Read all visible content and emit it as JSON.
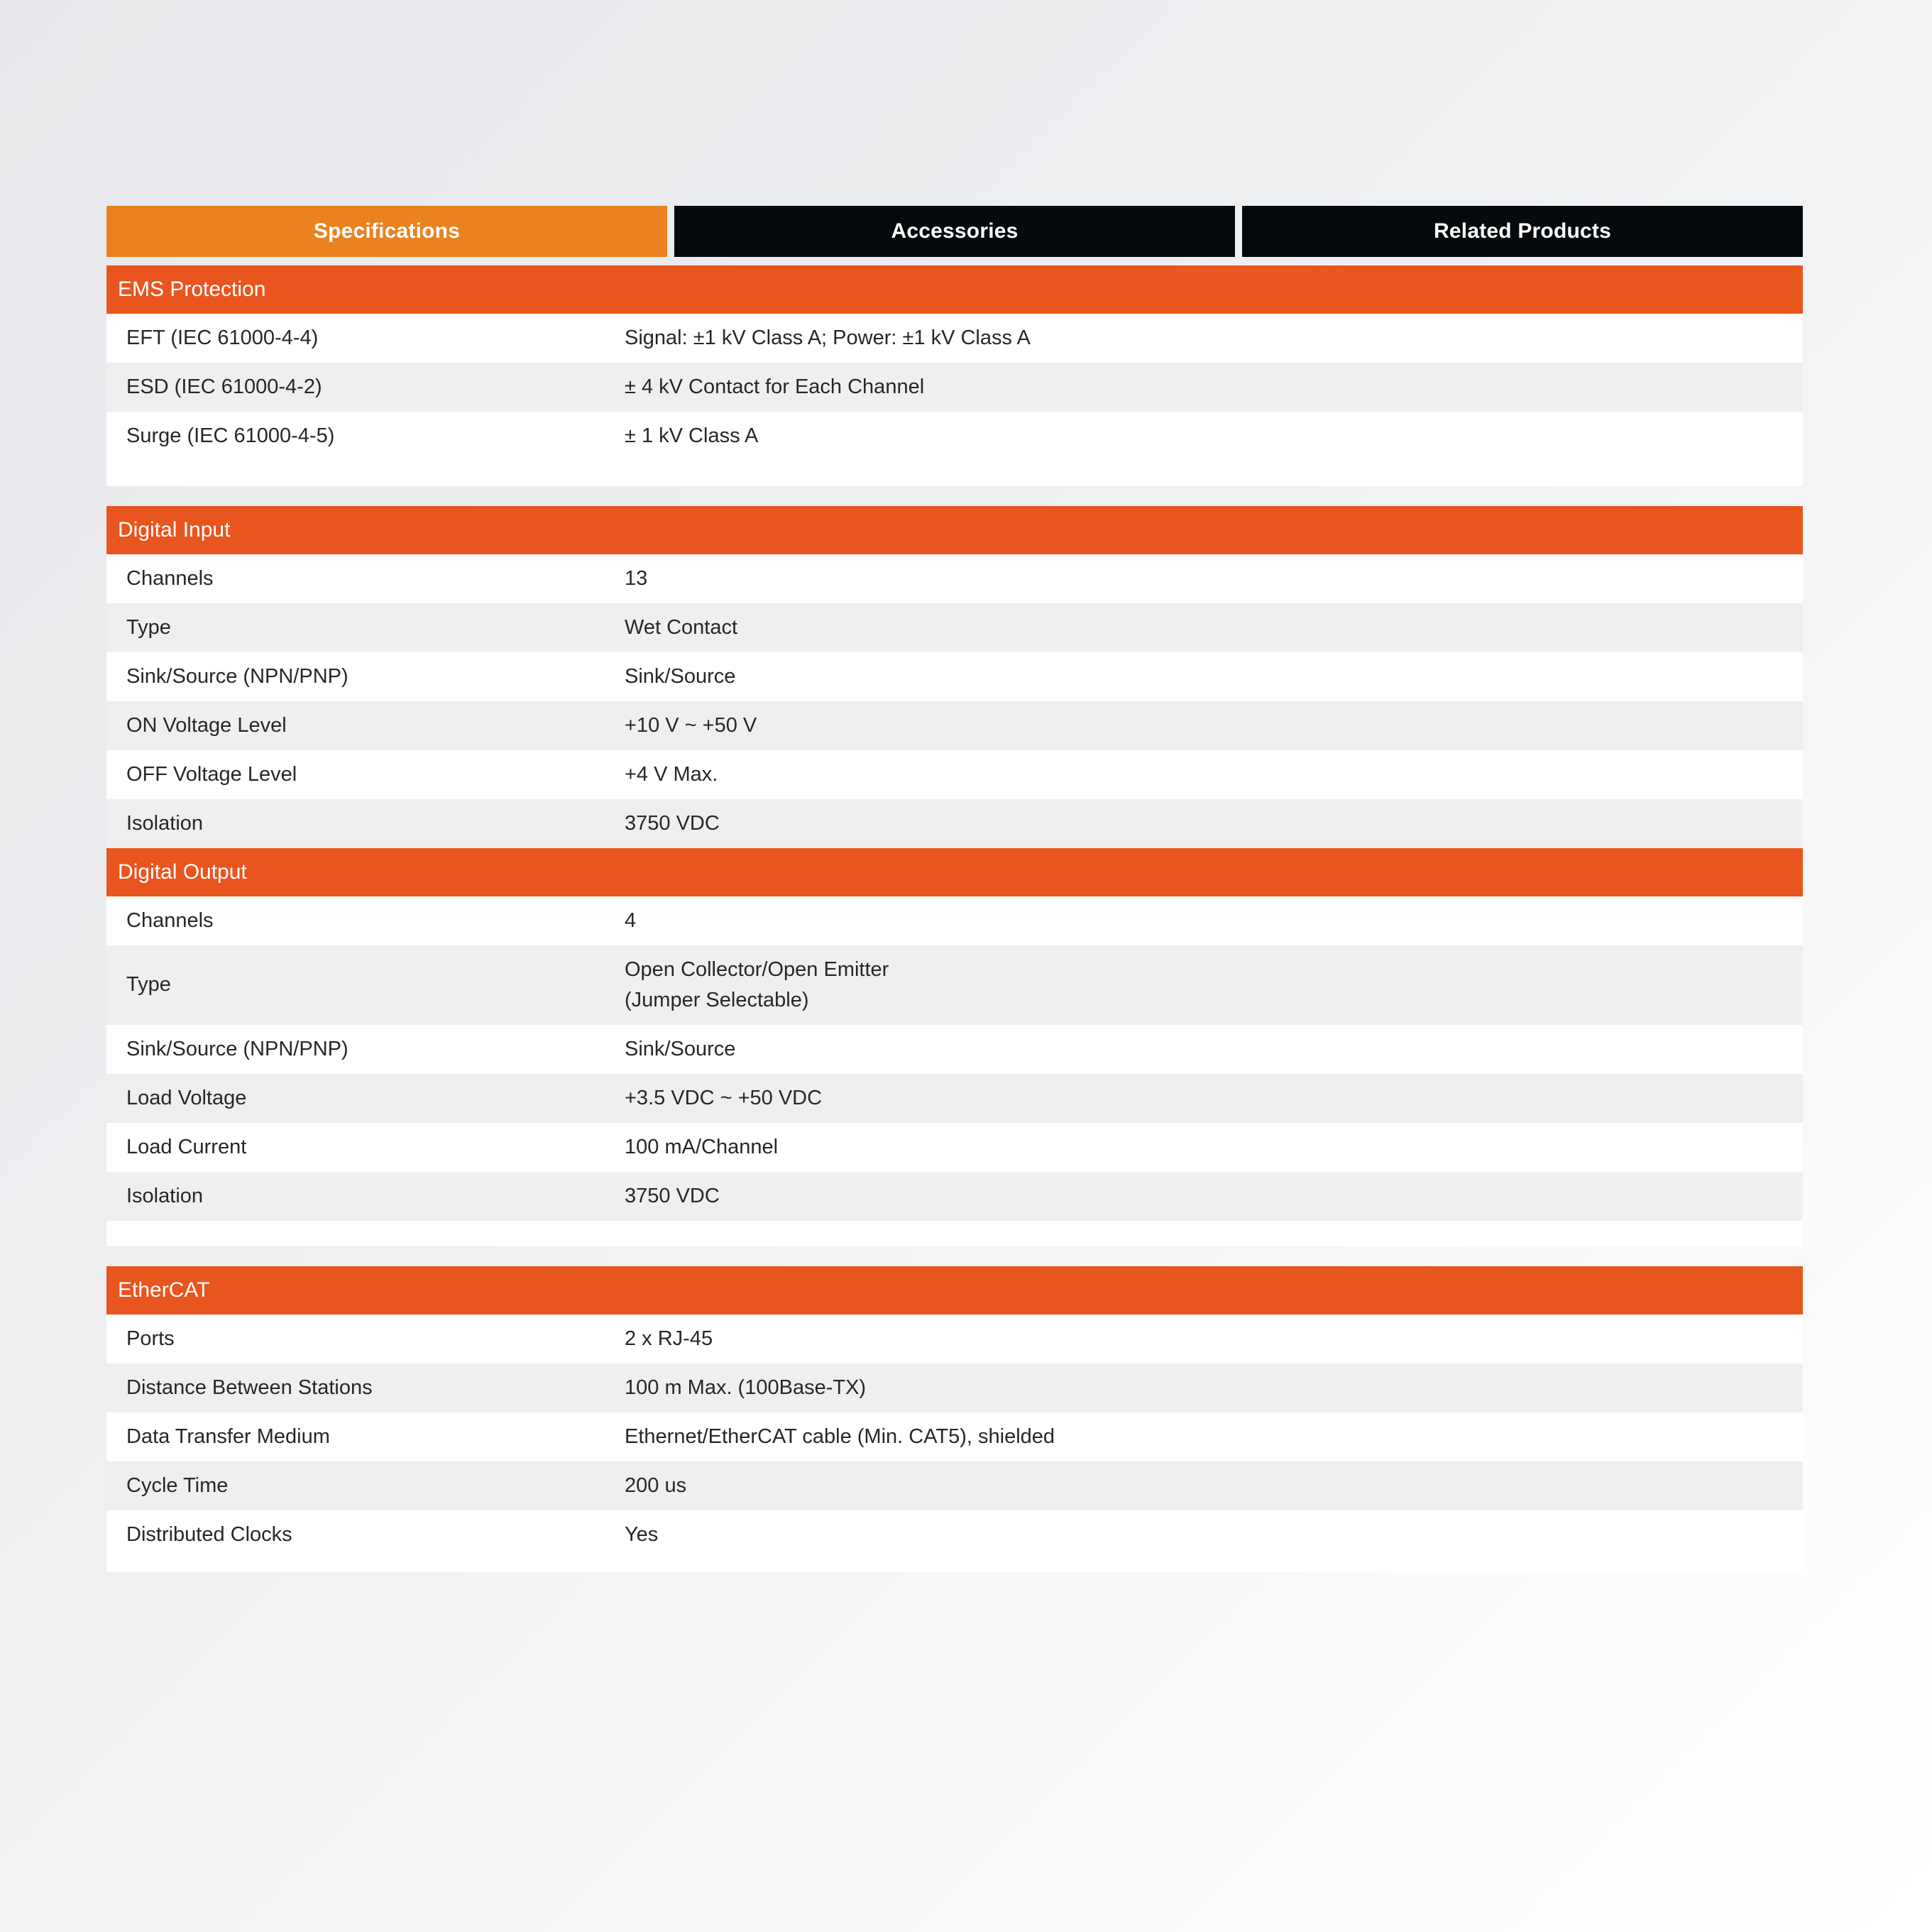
{
  "tabs": [
    {
      "label": "Specifications",
      "active": true
    },
    {
      "label": "Accessories",
      "active": false
    },
    {
      "label": "Related Products",
      "active": false
    }
  ],
  "colors": {
    "tab_active": "#E9821F",
    "tab_inactive": "#060A0C",
    "section_header": "#E9551F",
    "row_alt": "#EEEFEF",
    "row_base": "#FFFFFF",
    "text": "#26272A",
    "page_background": "#EBEDEF"
  },
  "sections": [
    {
      "title": "EMS Protection",
      "rows": [
        {
          "label": "EFT (IEC 61000-4-4)",
          "value": "Signal: ±1 kV Class A; Power: ±1 kV Class A"
        },
        {
          "label": "ESD (IEC 61000-4-2)",
          "value": "± 4 kV Contact for Each Channel"
        },
        {
          "label": "Surge (IEC 61000-4-5)",
          "value": "± 1 kV Class A"
        }
      ]
    },
    {
      "title": "Digital Input",
      "rows": [
        {
          "label": "Channels",
          "value": "13"
        },
        {
          "label": "Type",
          "value": "Wet Contact"
        },
        {
          "label": "Sink/Source (NPN/PNP)",
          "value": "Sink/Source"
        },
        {
          "label": "ON Voltage Level",
          "value": "+10 V ~ +50 V"
        },
        {
          "label": "OFF Voltage Level",
          "value": "+4 V Max."
        },
        {
          "label": "Isolation",
          "value": "3750 VDC"
        }
      ]
    },
    {
      "title": "Digital Output",
      "rows": [
        {
          "label": "Channels",
          "value": "4"
        },
        {
          "label": "Type",
          "value_lines": [
            "Open Collector/Open Emitter",
            "(Jumper Selectable)"
          ]
        },
        {
          "label": "Sink/Source (NPN/PNP)",
          "value": "Sink/Source"
        },
        {
          "label": "Load Voltage",
          "value": "+3.5 VDC ~ +50 VDC"
        },
        {
          "label": "Load Current",
          "value": "100 mA/Channel"
        },
        {
          "label": "Isolation",
          "value": "3750 VDC"
        }
      ]
    },
    {
      "title": "EtherCAT",
      "rows": [
        {
          "label": "Ports",
          "value": "2 x RJ-45"
        },
        {
          "label": "Distance Between Stations",
          "value": "100 m Max. (100Base-TX)"
        },
        {
          "label": "Data Transfer Medium",
          "value": "Ethernet/EtherCAT cable (Min. CAT5), shielded"
        },
        {
          "label": "Cycle Time",
          "value": "200 us"
        },
        {
          "label": "Distributed Clocks",
          "value": "Yes"
        }
      ]
    }
  ]
}
